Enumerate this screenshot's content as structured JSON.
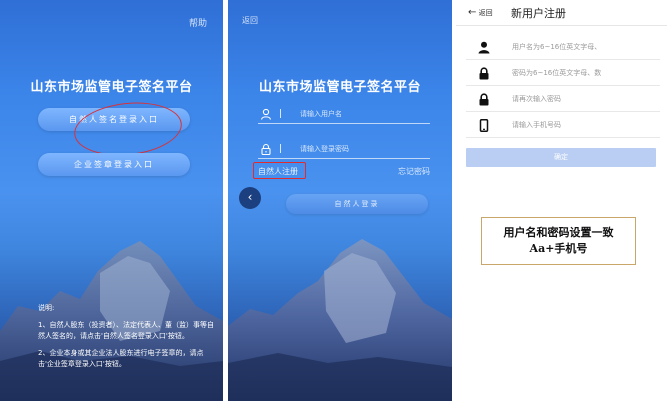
{
  "screen1": {
    "help": "帮助",
    "title": "山东市场监管电子签名平台",
    "natural_login_button": "自然人签名登录入口",
    "corp_login_button": "企业签章登录入口",
    "notes_heading": "说明:",
    "note1": "1、自然人股东（投资者）、法定代表人、董（监）事等自然人签名的，请点击'自然人签名登录入口'按钮。",
    "note2": "2、企业本身或其企业法人股东进行电子签章的，请点击'企业签章登录入口'按钮。"
  },
  "screen2": {
    "back": "返回",
    "title": "山东市场监管电子签名平台",
    "username_placeholder": "请输入用户名",
    "password_placeholder": "请输入登录密码",
    "register_link": "自然人注册",
    "forgot_link": "忘记密码",
    "login_button": "自然人登录"
  },
  "screen3": {
    "back": "返回",
    "title": "新用户注册",
    "username_placeholder": "用户名为6~16位英文字母、",
    "password_placeholder": "密码为6~16位英文字母、数",
    "password_confirm_placeholder": "请再次输入密码",
    "phone_placeholder": "请输入手机号码",
    "confirm_button": "确定"
  },
  "annotation": {
    "line1": "用户名和密码设置一致",
    "line2": "Aa+手机号"
  },
  "colors": {
    "highlight_red": "#d8323a",
    "brand_blue": "#3c86ea",
    "confirm_disabled": "#b9cef2"
  }
}
